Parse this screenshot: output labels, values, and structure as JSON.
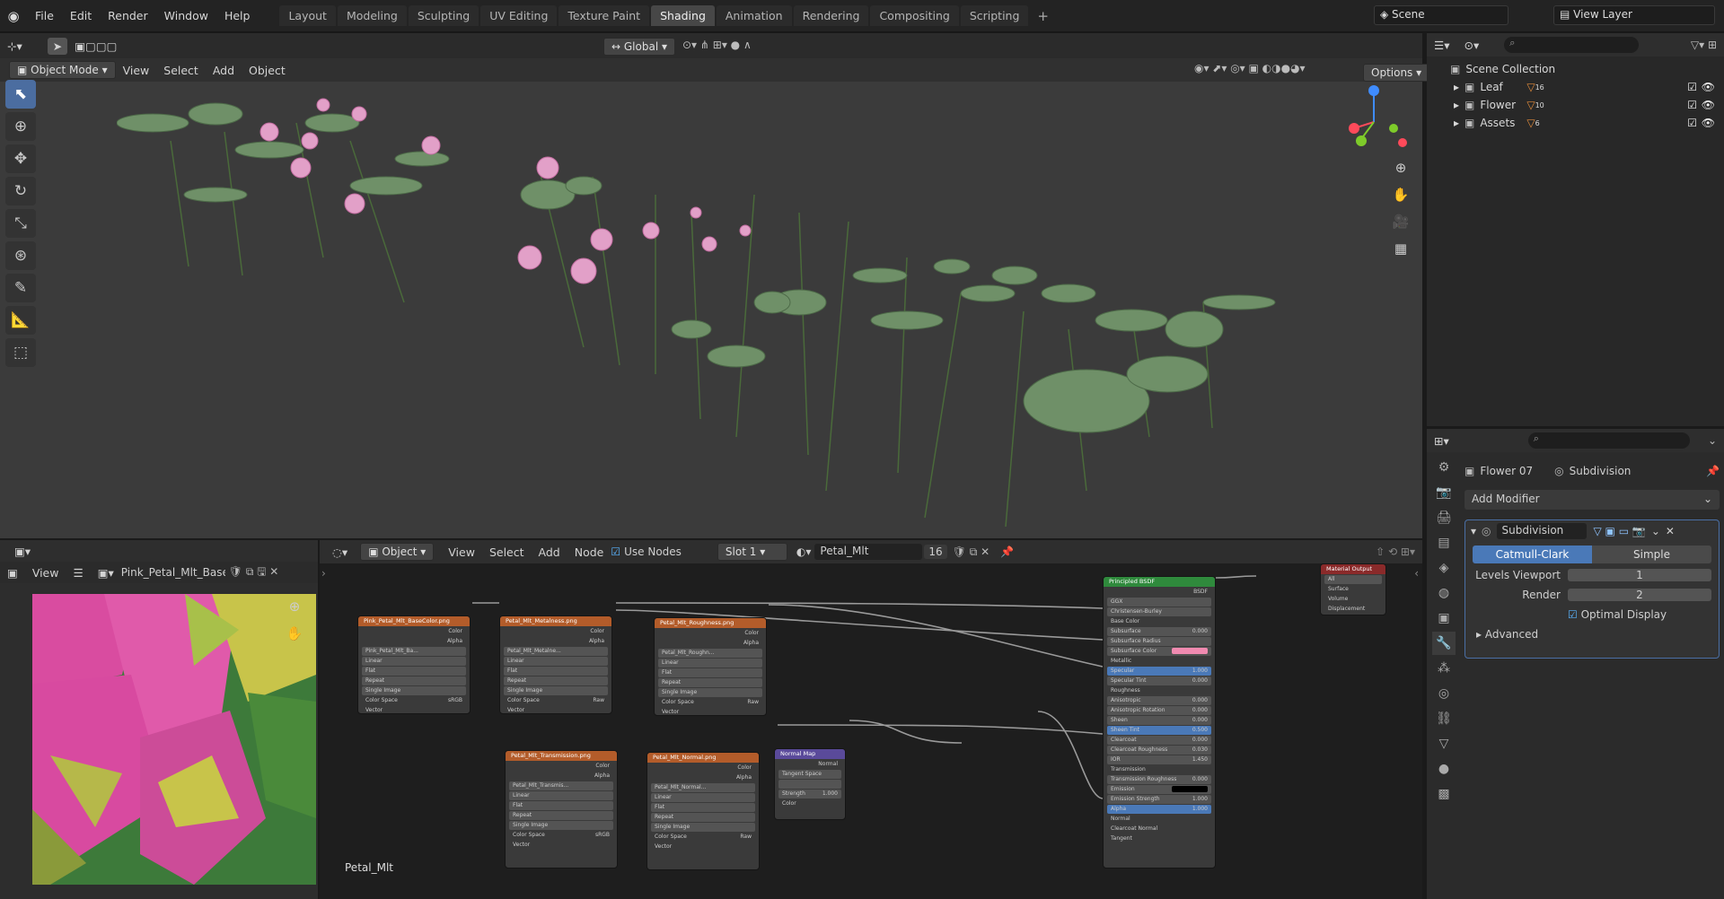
{
  "menu": {
    "file": "File",
    "edit": "Edit",
    "render": "Render",
    "window": "Window",
    "help": "Help"
  },
  "workspaces": [
    "Layout",
    "Modeling",
    "Sculpting",
    "UV Editing",
    "Texture Paint",
    "Shading",
    "Animation",
    "Rendering",
    "Compositing",
    "Scripting"
  ],
  "active_workspace": "Shading",
  "scene": {
    "name": "Scene",
    "view_layer": "View Layer"
  },
  "viewport": {
    "orientation": "Global",
    "mode": "Object Mode",
    "menus": [
      "View",
      "Select",
      "Add",
      "Object"
    ],
    "options": "Options"
  },
  "outliner": {
    "root": "Scene Collection",
    "items": [
      {
        "label": "Leaf",
        "badge": "16"
      },
      {
        "label": "Flower",
        "badge": "10"
      },
      {
        "label": "Assets",
        "badge": "6"
      }
    ]
  },
  "properties": {
    "object": "Flower 07",
    "modifier_name": "Subdivision",
    "add_modifier": "Add Modifier",
    "mod_title": "Subdivision",
    "catmull": "Catmull-Clark",
    "simple": "Simple",
    "levels_label": "Levels Viewport",
    "levels_value": "1",
    "render_label": "Render",
    "render_value": "2",
    "optimal": "Optimal Display",
    "advanced": "Advanced"
  },
  "image_editor": {
    "view": "View",
    "image": "Pink_Petal_Mlt_Base..."
  },
  "node_editor": {
    "object": "Object",
    "menus": [
      "View",
      "Select",
      "Add",
      "Node"
    ],
    "use_nodes": "Use Nodes",
    "slot": "Slot 1",
    "material": "Petal_Mlt",
    "users": "16",
    "material_label": "Petal_Mlt",
    "nodes": {
      "base": {
        "title": "Pink_Petal_Mlt_BaseColor.png",
        "img": "Pink_Petal_Mlt_Ba...",
        "colorspace": "sRGB"
      },
      "metal": {
        "title": "Petal_Mlt_Metalness.png",
        "img": "Petal_Mlt_Metalne...",
        "colorspace": "Raw"
      },
      "rough": {
        "title": "Petal_Mlt_Roughness.png",
        "img": "Petal_Mlt_Roughn...",
        "colorspace": "Raw"
      },
      "trans": {
        "title": "Petal_Mlt_Transmission.png",
        "img": "Petal_Mlt_Transmis...",
        "colorspace": "sRGB"
      },
      "normal": {
        "title": "Petal_Mlt_Normal.png",
        "img": "Petal_Mlt_Normal...",
        "colorspace": "Raw"
      },
      "normalmap": {
        "title": "Normal Map",
        "space": "Tangent Space",
        "strength_label": "Strength",
        "strength": "1.000",
        "out": "Normal",
        "in": "Color"
      },
      "bsdf": {
        "title": "Principled BSDF",
        "out": "BSDF",
        "dist": "GGX",
        "sss": "Christensen-Burley"
      },
      "output": {
        "title": "Material Output",
        "target": "All",
        "surface": "Surface",
        "volume": "Volume",
        "displacement": "Displacement"
      }
    },
    "common": {
      "color": "Color",
      "alpha": "Alpha",
      "linear": "Linear",
      "flat": "Flat",
      "repeat": "Repeat",
      "single": "Single Image",
      "cs": "Color Space",
      "vector": "Vector"
    },
    "bsdf_rows": [
      {
        "label": "Base Color",
        "value": ""
      },
      {
        "label": "Subsurface",
        "value": "0.000"
      },
      {
        "label": "Subsurface Radius",
        "value": ""
      },
      {
        "label": "Subsurface Color",
        "value": ""
      },
      {
        "label": "Metallic",
        "value": ""
      },
      {
        "label": "Specular",
        "value": "1.000"
      },
      {
        "label": "Specular Tint",
        "value": "0.000"
      },
      {
        "label": "Roughness",
        "value": ""
      },
      {
        "label": "Anisotropic",
        "value": "0.000"
      },
      {
        "label": "Anisotropic Rotation",
        "value": "0.000"
      },
      {
        "label": "Sheen",
        "value": "0.000"
      },
      {
        "label": "Sheen Tint",
        "value": "0.500"
      },
      {
        "label": "Clearcoat",
        "value": "0.000"
      },
      {
        "label": "Clearcoat Roughness",
        "value": "0.030"
      },
      {
        "label": "IOR",
        "value": "1.450"
      },
      {
        "label": "Transmission",
        "value": ""
      },
      {
        "label": "Transmission Roughness",
        "value": "0.000"
      },
      {
        "label": "Emission",
        "value": ""
      },
      {
        "label": "Emission Strength",
        "value": "1.000"
      },
      {
        "label": "Alpha",
        "value": "1.000"
      },
      {
        "label": "Normal",
        "value": ""
      },
      {
        "label": "Clearcoat Normal",
        "value": ""
      },
      {
        "label": "Tangent",
        "value": ""
      }
    ]
  },
  "colors": {
    "accent": "#4b6da0",
    "texture_header": "#b35c2a",
    "bsdf_header": "#2f8a3c",
    "output_header": "#8a2a2a",
    "vector_header": "#5a4a9a",
    "pink": "#f08ab0"
  }
}
